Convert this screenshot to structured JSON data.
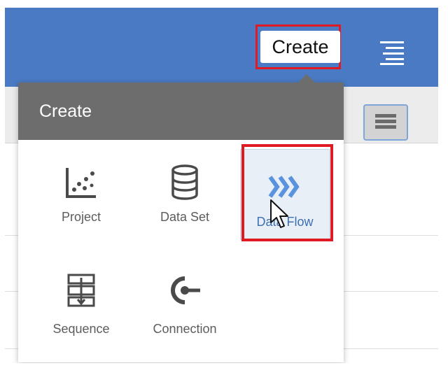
{
  "toolbar": {
    "create_label": "Create"
  },
  "dropdown": {
    "title": "Create",
    "items": [
      {
        "label": "Project",
        "icon": "scatter-chart-icon"
      },
      {
        "label": "Data Set",
        "icon": "database-icon"
      },
      {
        "label": "Data Flow",
        "icon": "chevrons-right-icon"
      },
      {
        "label": "Sequence",
        "icon": "sequence-icon"
      },
      {
        "label": "Connection",
        "icon": "connection-plug-icon"
      }
    ]
  },
  "colors": {
    "topbar": "#4a7ac3",
    "dropdown_header": "#6d6d6d",
    "highlight": "#e01a22",
    "accent": "#4a7ac3"
  }
}
